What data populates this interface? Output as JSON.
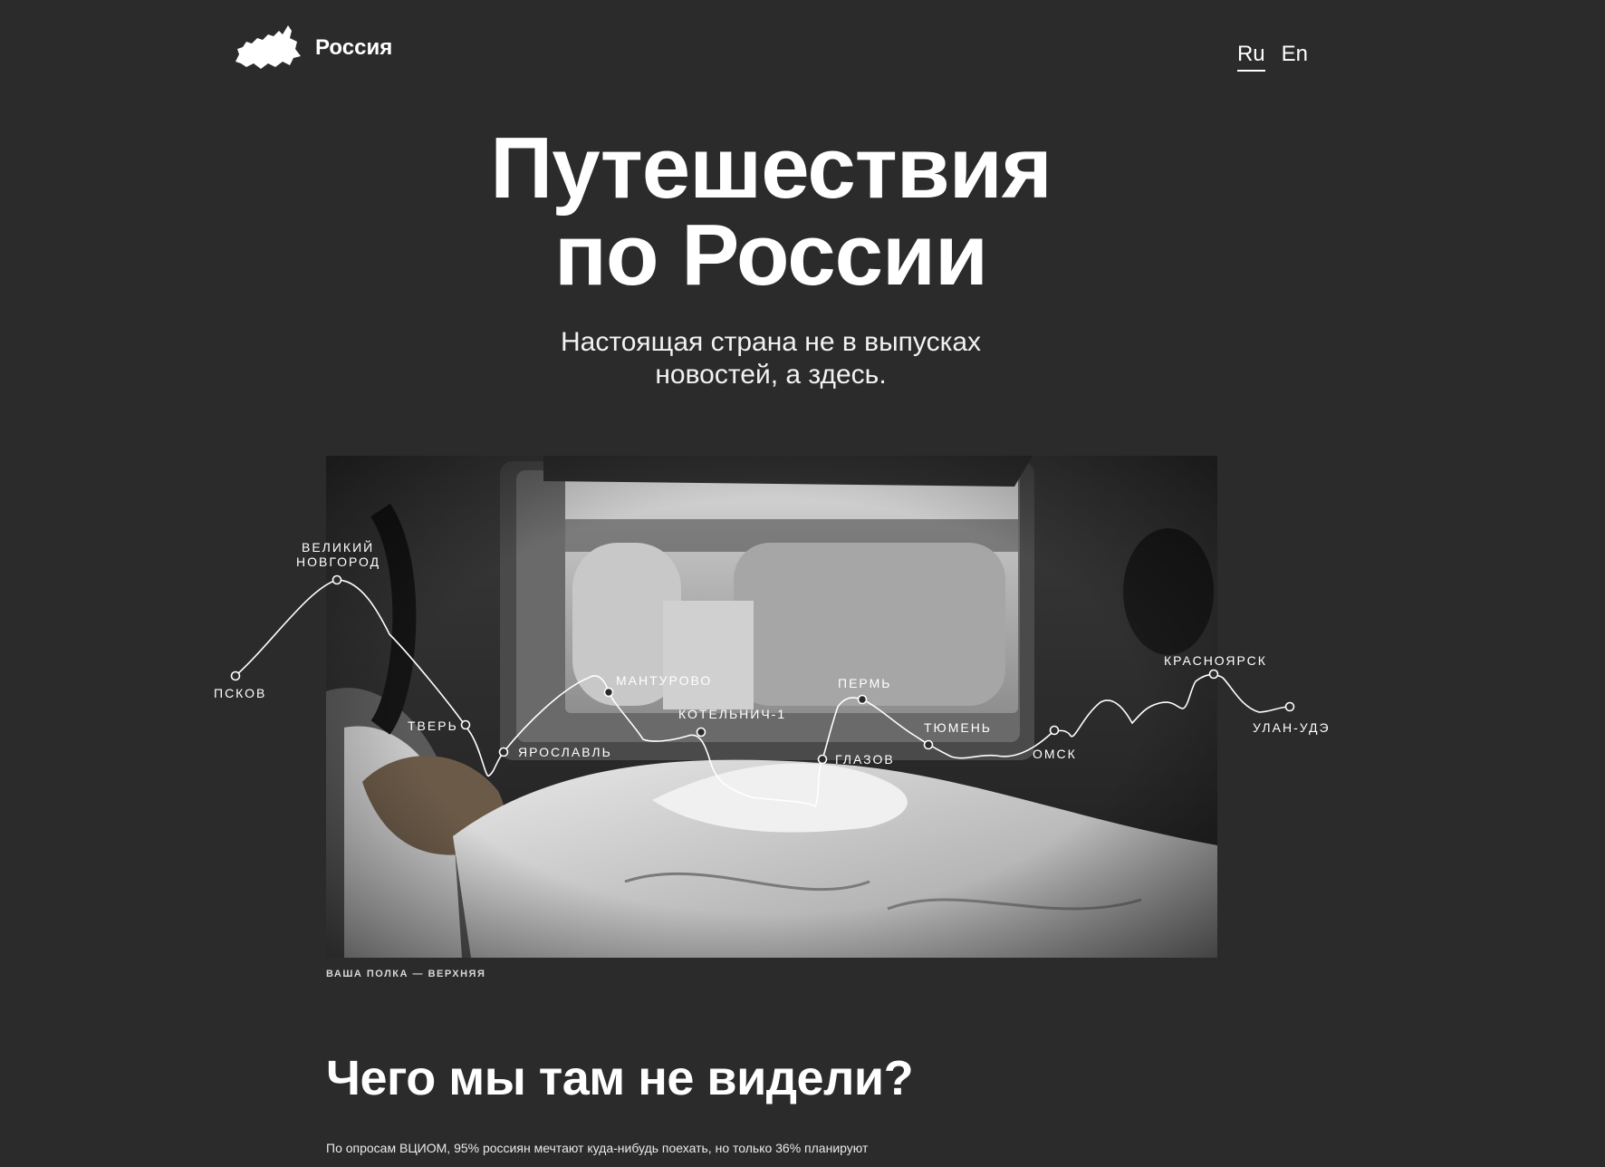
{
  "header": {
    "logo_text": "Россия",
    "languages": [
      {
        "label": "Ru",
        "active": true
      },
      {
        "label": "En",
        "active": false
      }
    ]
  },
  "hero": {
    "title_line1": "Путешествия",
    "title_line2": "по России",
    "subtitle_line1": "Настоящая страна не в выпусках",
    "subtitle_line2": "новостей, а здесь."
  },
  "route": {
    "stops": [
      "ПСКОВ",
      "ВЕЛИКИЙ",
      "НОВГОРОД",
      "ТВЕРЬ",
      "ЯРОСЛАВЛЬ",
      "МАНТУРОВО",
      "КОТЕЛЬНИЧ-1",
      "ГЛАЗОВ",
      "ПЕРМЬ",
      "ТЮМЕНЬ",
      "ОМСК",
      "КРАСНОЯРСК",
      "УЛАН-УДЭ"
    ]
  },
  "photo": {
    "caption": "ВАША ПОЛКА — ВЕРХНЯЯ"
  },
  "section": {
    "title": "Чего мы там не видели?",
    "paragraph": "По опросам ВЦИОМ, 95% россиян мечтают куда-нибудь поехать, но только 36% планируют"
  },
  "colors": {
    "background": "#2b2b2c",
    "text": "#ffffff"
  }
}
